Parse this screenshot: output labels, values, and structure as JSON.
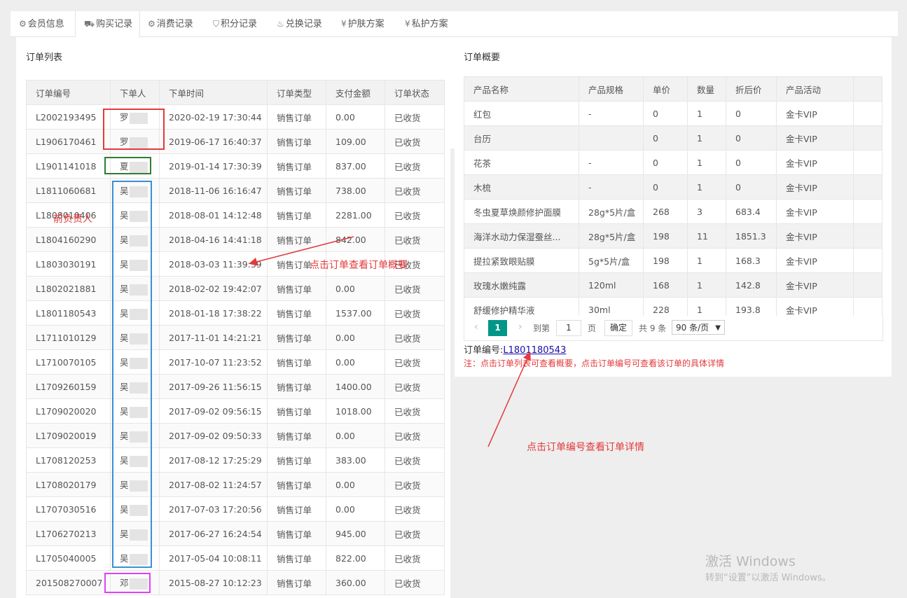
{
  "tabs": [
    {
      "icon": "gear-icon",
      "glyph": "⚙",
      "label": "会员信息",
      "active": false
    },
    {
      "icon": "cart-icon",
      "glyph": "🛒",
      "label": "购买记录",
      "active": true
    },
    {
      "icon": "gear-icon",
      "glyph": "⚙",
      "label": "消费记录",
      "active": false
    },
    {
      "icon": "shield-icon",
      "glyph": "⛉",
      "label": "积分记录",
      "active": false
    },
    {
      "icon": "flame-icon",
      "glyph": "♨",
      "label": "兑换记录",
      "active": false
    },
    {
      "icon": "yen-icon",
      "glyph": "¥",
      "label": "护肤方案",
      "active": false
    },
    {
      "icon": "yen-icon",
      "glyph": "¥",
      "label": "私护方案",
      "active": false
    }
  ],
  "order_list": {
    "title": "订单列表",
    "headers": [
      "订单编号",
      "下单人",
      "下单时间",
      "订单类型",
      "支付金额",
      "订单状态"
    ],
    "rows": [
      [
        "L2002193495",
        "罗",
        "2020-02-19 17:30:44",
        "销售订单",
        "0.00",
        "已收货"
      ],
      [
        "L1906170461",
        "罗",
        "2019-06-17 16:40:37",
        "销售订单",
        "109.00",
        "已收货"
      ],
      [
        "L1901141018",
        "夏",
        "2019-01-14 17:30:39",
        "销售订单",
        "837.00",
        "已收货"
      ],
      [
        "L1811060681",
        "吴",
        "2018-11-06 16:16:47",
        "销售订单",
        "738.00",
        "已收货"
      ],
      [
        "L1808010406",
        "吴",
        "2018-08-01 14:12:48",
        "销售订单",
        "2281.00",
        "已收货"
      ],
      [
        "L1804160290",
        "吴",
        "2018-04-16 14:41:18",
        "销售订单",
        "842.00",
        "已收货"
      ],
      [
        "L1803030191",
        "吴",
        "2018-03-03 11:39:39",
        "销售订单",
        "",
        "已收货"
      ],
      [
        "L1802021881",
        "吴",
        "2018-02-02 19:42:07",
        "销售订单",
        "0.00",
        "已收货"
      ],
      [
        "L1801180543",
        "吴",
        "2018-01-18 17:38:22",
        "销售订单",
        "1537.00",
        "已收货"
      ],
      [
        "L1711010129",
        "吴",
        "2017-11-01 14:21:21",
        "销售订单",
        "0.00",
        "已收货"
      ],
      [
        "L1710070105",
        "吴",
        "2017-10-07 11:23:52",
        "销售订单",
        "0.00",
        "已收货"
      ],
      [
        "L1709260159",
        "吴",
        "2017-09-26 11:56:15",
        "销售订单",
        "1400.00",
        "已收货"
      ],
      [
        "L1709020020",
        "吴",
        "2017-09-02 09:56:15",
        "销售订单",
        "1018.00",
        "已收货"
      ],
      [
        "L1709020019",
        "吴",
        "2017-09-02 09:50:33",
        "销售订单",
        "0.00",
        "已收货"
      ],
      [
        "L1708120253",
        "吴",
        "2017-08-12 17:25:29",
        "销售订单",
        "383.00",
        "已收货"
      ],
      [
        "L1708020179",
        "吴",
        "2017-08-02 11:24:57",
        "销售订单",
        "0.00",
        "已收货"
      ],
      [
        "L1707030516",
        "吴",
        "2017-07-03 17:20:56",
        "销售订单",
        "0.00",
        "已收货"
      ],
      [
        "L1706270213",
        "吴",
        "2017-06-27 16:24:54",
        "销售订单",
        "945.00",
        "已收货"
      ],
      [
        "L1705040005",
        "吴",
        "2017-05-04 10:08:11",
        "销售订单",
        "822.00",
        "已收货"
      ],
      [
        "201508270007",
        "邓",
        "2015-08-27 10:12:23",
        "销售订单",
        "360.00",
        "已收货"
      ]
    ]
  },
  "order_summary": {
    "title": "订单概要",
    "headers": [
      "产品名称",
      "产品规格",
      "单价",
      "数量",
      "折后价",
      "产品活动"
    ],
    "rows": [
      [
        "红包",
        "-",
        "0",
        "1",
        "0",
        "金卡VIP"
      ],
      [
        "台历",
        "",
        "0",
        "1",
        "0",
        "金卡VIP"
      ],
      [
        "花茶",
        "-",
        "0",
        "1",
        "0",
        "金卡VIP"
      ],
      [
        "木梳",
        "-",
        "0",
        "1",
        "0",
        "金卡VIP"
      ],
      [
        "冬虫夏草焕颜修护面膜",
        "28g*5片/盒",
        "268",
        "3",
        "683.4",
        "金卡VIP"
      ],
      [
        "海洋水动力保湿蚕丝...",
        "28g*5片/盒",
        "198",
        "11",
        "1851.3",
        "金卡VIP"
      ],
      [
        "提拉紧致眼贴膜",
        "5g*5片/盒",
        "198",
        "1",
        "168.3",
        "金卡VIP"
      ],
      [
        "玫瑰水嫩纯露",
        "120ml",
        "168",
        "1",
        "142.8",
        "金卡VIP"
      ],
      [
        "舒缓修护精华液",
        "30ml",
        "228",
        "1",
        "193.8",
        "金卡VIP"
      ]
    ],
    "pager": {
      "prev": "‹",
      "current": "1",
      "next": "›",
      "goto_label": "到第",
      "goto_value": "1",
      "page_unit": "页",
      "confirm": "确定",
      "total": "共 9 条",
      "per_page": "90 条/页"
    },
    "order_no_label": "订单编号:",
    "order_no_link": "L1801180543",
    "note": "注：点击订单列表可查看概要，点击订单编号可查看该订单的具体详情"
  },
  "annotations": {
    "responsible_person": "前负责人",
    "click_list": "点击订单查看订单概要",
    "click_order_no": "点击订单编号查看订单详情"
  },
  "colors": {
    "red_box": "#e4393c",
    "green_box": "#2e7d32",
    "blue_box": "#3a8fd6",
    "magenta_box": "#e040fb",
    "pager_active": "#009688"
  },
  "watermark": {
    "line1": "激活 Windows",
    "line2": "转到“设置”以激活 Windows。"
  }
}
